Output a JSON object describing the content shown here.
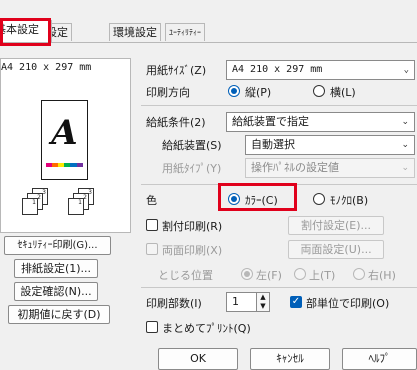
{
  "tabs": [
    {
      "label": "基本設定"
    },
    {
      "label": "応用設定"
    },
    {
      "label": "環境設定"
    },
    {
      "label": "ﾕｰﾃｨﾘﾃｨｰ"
    }
  ],
  "preview": {
    "paper_caption": "A4 210 x 297 mm",
    "paper_letter": "A",
    "stack_numbers": {
      "a": "3",
      "b": "2",
      "c": "1"
    }
  },
  "left_buttons": [
    {
      "label": "ｾｷｭﾘﾃｨｰ印刷(G)..."
    },
    {
      "label": "排紙設定(1)..."
    },
    {
      "label": "設定確認(N)..."
    },
    {
      "label": "初期値に戻す(D)"
    }
  ],
  "paper_size": {
    "label": "用紙ｻｲｽﾞ(Z)",
    "value": "A4 210 x 297 mm"
  },
  "orientation": {
    "label": "印刷方向",
    "portrait": "縦(P)",
    "landscape": "横(L)",
    "selected": "portrait"
  },
  "feed": {
    "label": "給紙条件(2)",
    "value": "給紙装置で指定"
  },
  "feed_device": {
    "label": "給紙装置(S)",
    "value": "自動選択"
  },
  "paper_type": {
    "label": "用紙ﾀｲﾌﾟ(Y)",
    "value": "操作ﾊﾟﾈﾙの設定値"
  },
  "color": {
    "label": "色",
    "color_option": "ｶﾗｰ(C)",
    "mono_option": "ﾓﾉｸﾛ(B)",
    "selected": "color"
  },
  "nup": {
    "label": "割付印刷(R)",
    "settings_button": "割付設定(E)..."
  },
  "duplex": {
    "label": "両面印刷(X)",
    "settings_button": "両面設定(U)..."
  },
  "binding": {
    "label": "とじる位置",
    "left": "左(F)",
    "top": "上(T)",
    "right": "右(H)"
  },
  "copies": {
    "label": "印刷部数(I)",
    "value": "1",
    "collate_label": "部単位で印刷(O)"
  },
  "combine": {
    "label": "まとめてﾌﾟﾘﾝﾄ(Q)"
  },
  "bottom_buttons": {
    "ok": "OK",
    "cancel": "ｷｬﾝｾﾙ",
    "help": "ﾍﾙﾌﾟ"
  },
  "colors": {
    "highlight_box": "#e0001b",
    "accent": "#005fb8",
    "background": "#f0f0f0"
  }
}
